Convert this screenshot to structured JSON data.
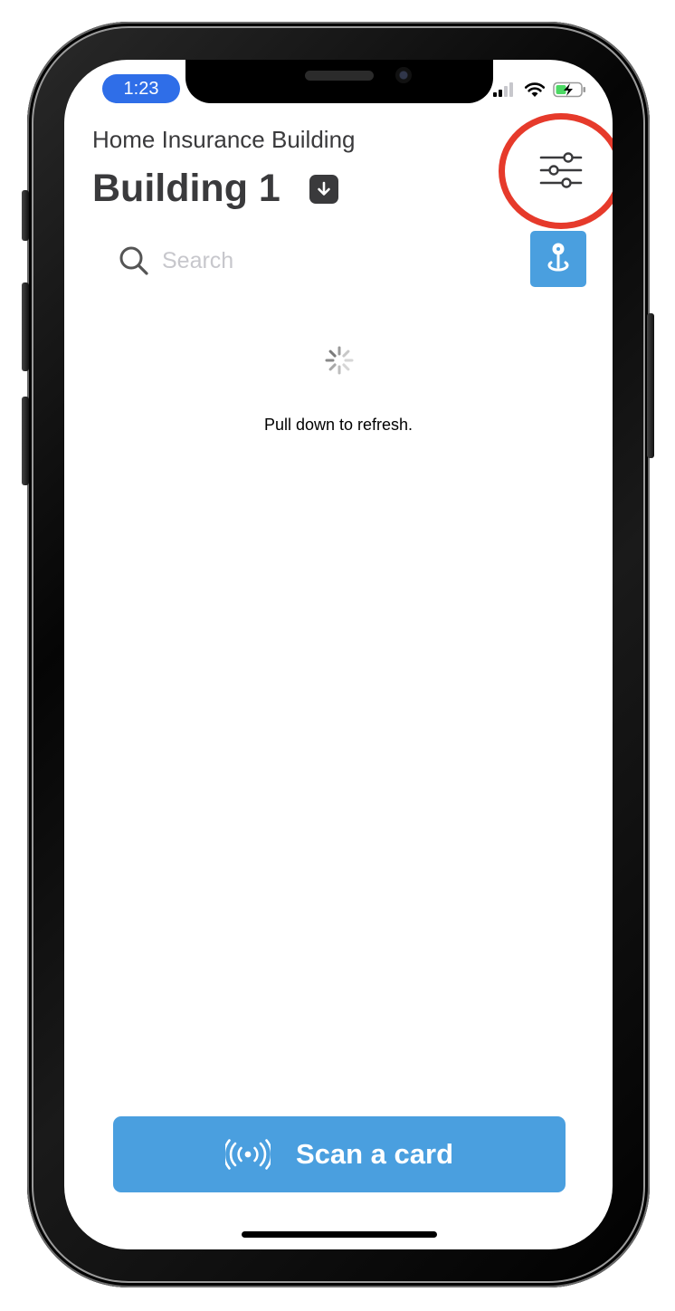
{
  "status_bar": {
    "time": "1:23"
  },
  "header": {
    "subtitle": "Home Insurance Building",
    "title": "Building 1"
  },
  "search": {
    "placeholder": "Search"
  },
  "content": {
    "empty_message": "Pull down to refresh."
  },
  "footer": {
    "scan_label": "Scan a card"
  },
  "icons": {
    "download": "download-arrow-icon",
    "filter": "sliders-icon",
    "search": "search-icon",
    "location": "map-pin-icon",
    "nfc": "nfc-wave-icon"
  },
  "colors": {
    "accent_blue": "#4a9fdf",
    "time_pill": "#2f6ee8",
    "highlight_ring": "#e63a2b",
    "text_dark": "#3a3a3c"
  }
}
